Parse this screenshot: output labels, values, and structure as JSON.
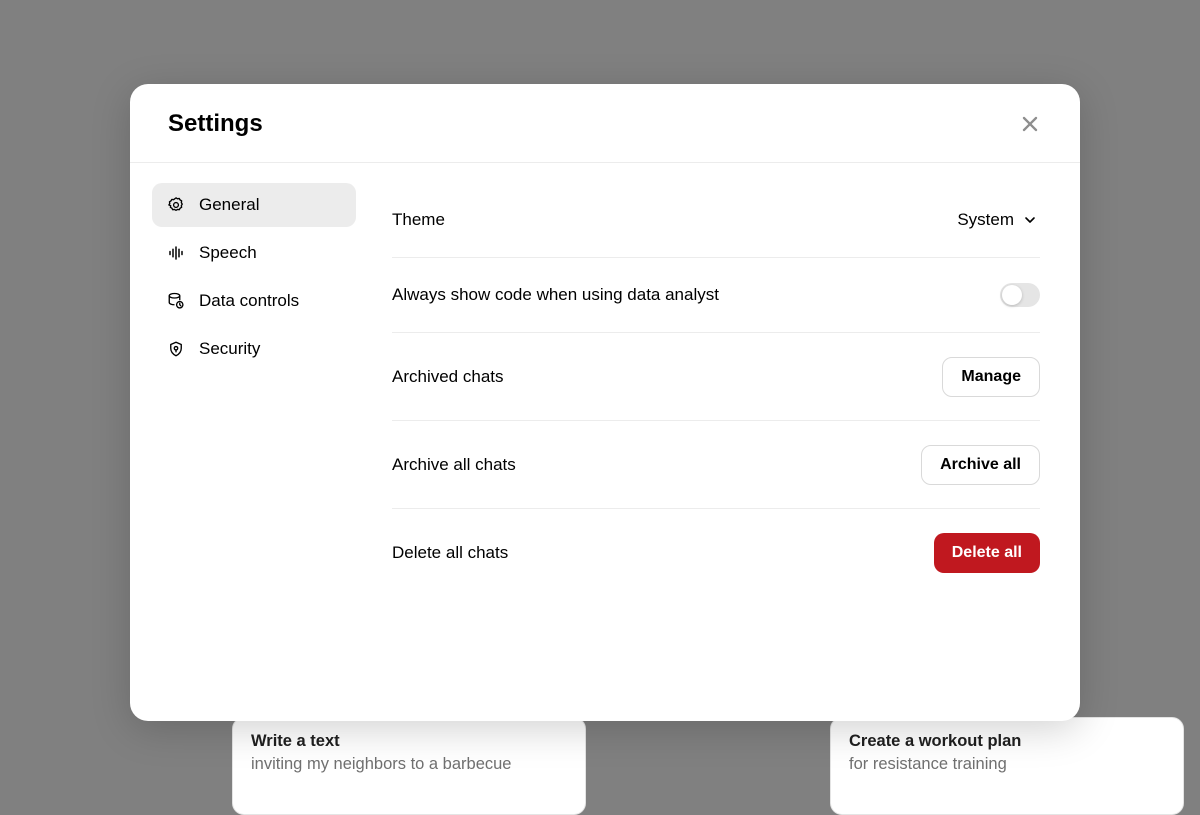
{
  "modal": {
    "title": "Settings",
    "sidebar": {
      "items": [
        {
          "label": "General",
          "active": true
        },
        {
          "label": "Speech"
        },
        {
          "label": "Data controls"
        },
        {
          "label": "Security"
        }
      ]
    },
    "content": {
      "theme": {
        "label": "Theme",
        "value": "System"
      },
      "code_toggle": {
        "label": "Always show code when using data analyst"
      },
      "archived": {
        "label": "Archived chats",
        "button": "Manage"
      },
      "archive_all": {
        "label": "Archive all chats",
        "button": "Archive all"
      },
      "delete_all": {
        "label": "Delete all chats",
        "button": "Delete all"
      }
    }
  },
  "bg_cards": [
    {
      "title": "Write a text",
      "sub": "inviting my neighbors to a barbecue"
    },
    {
      "title": "Create a workout plan",
      "sub": "for resistance training"
    }
  ]
}
